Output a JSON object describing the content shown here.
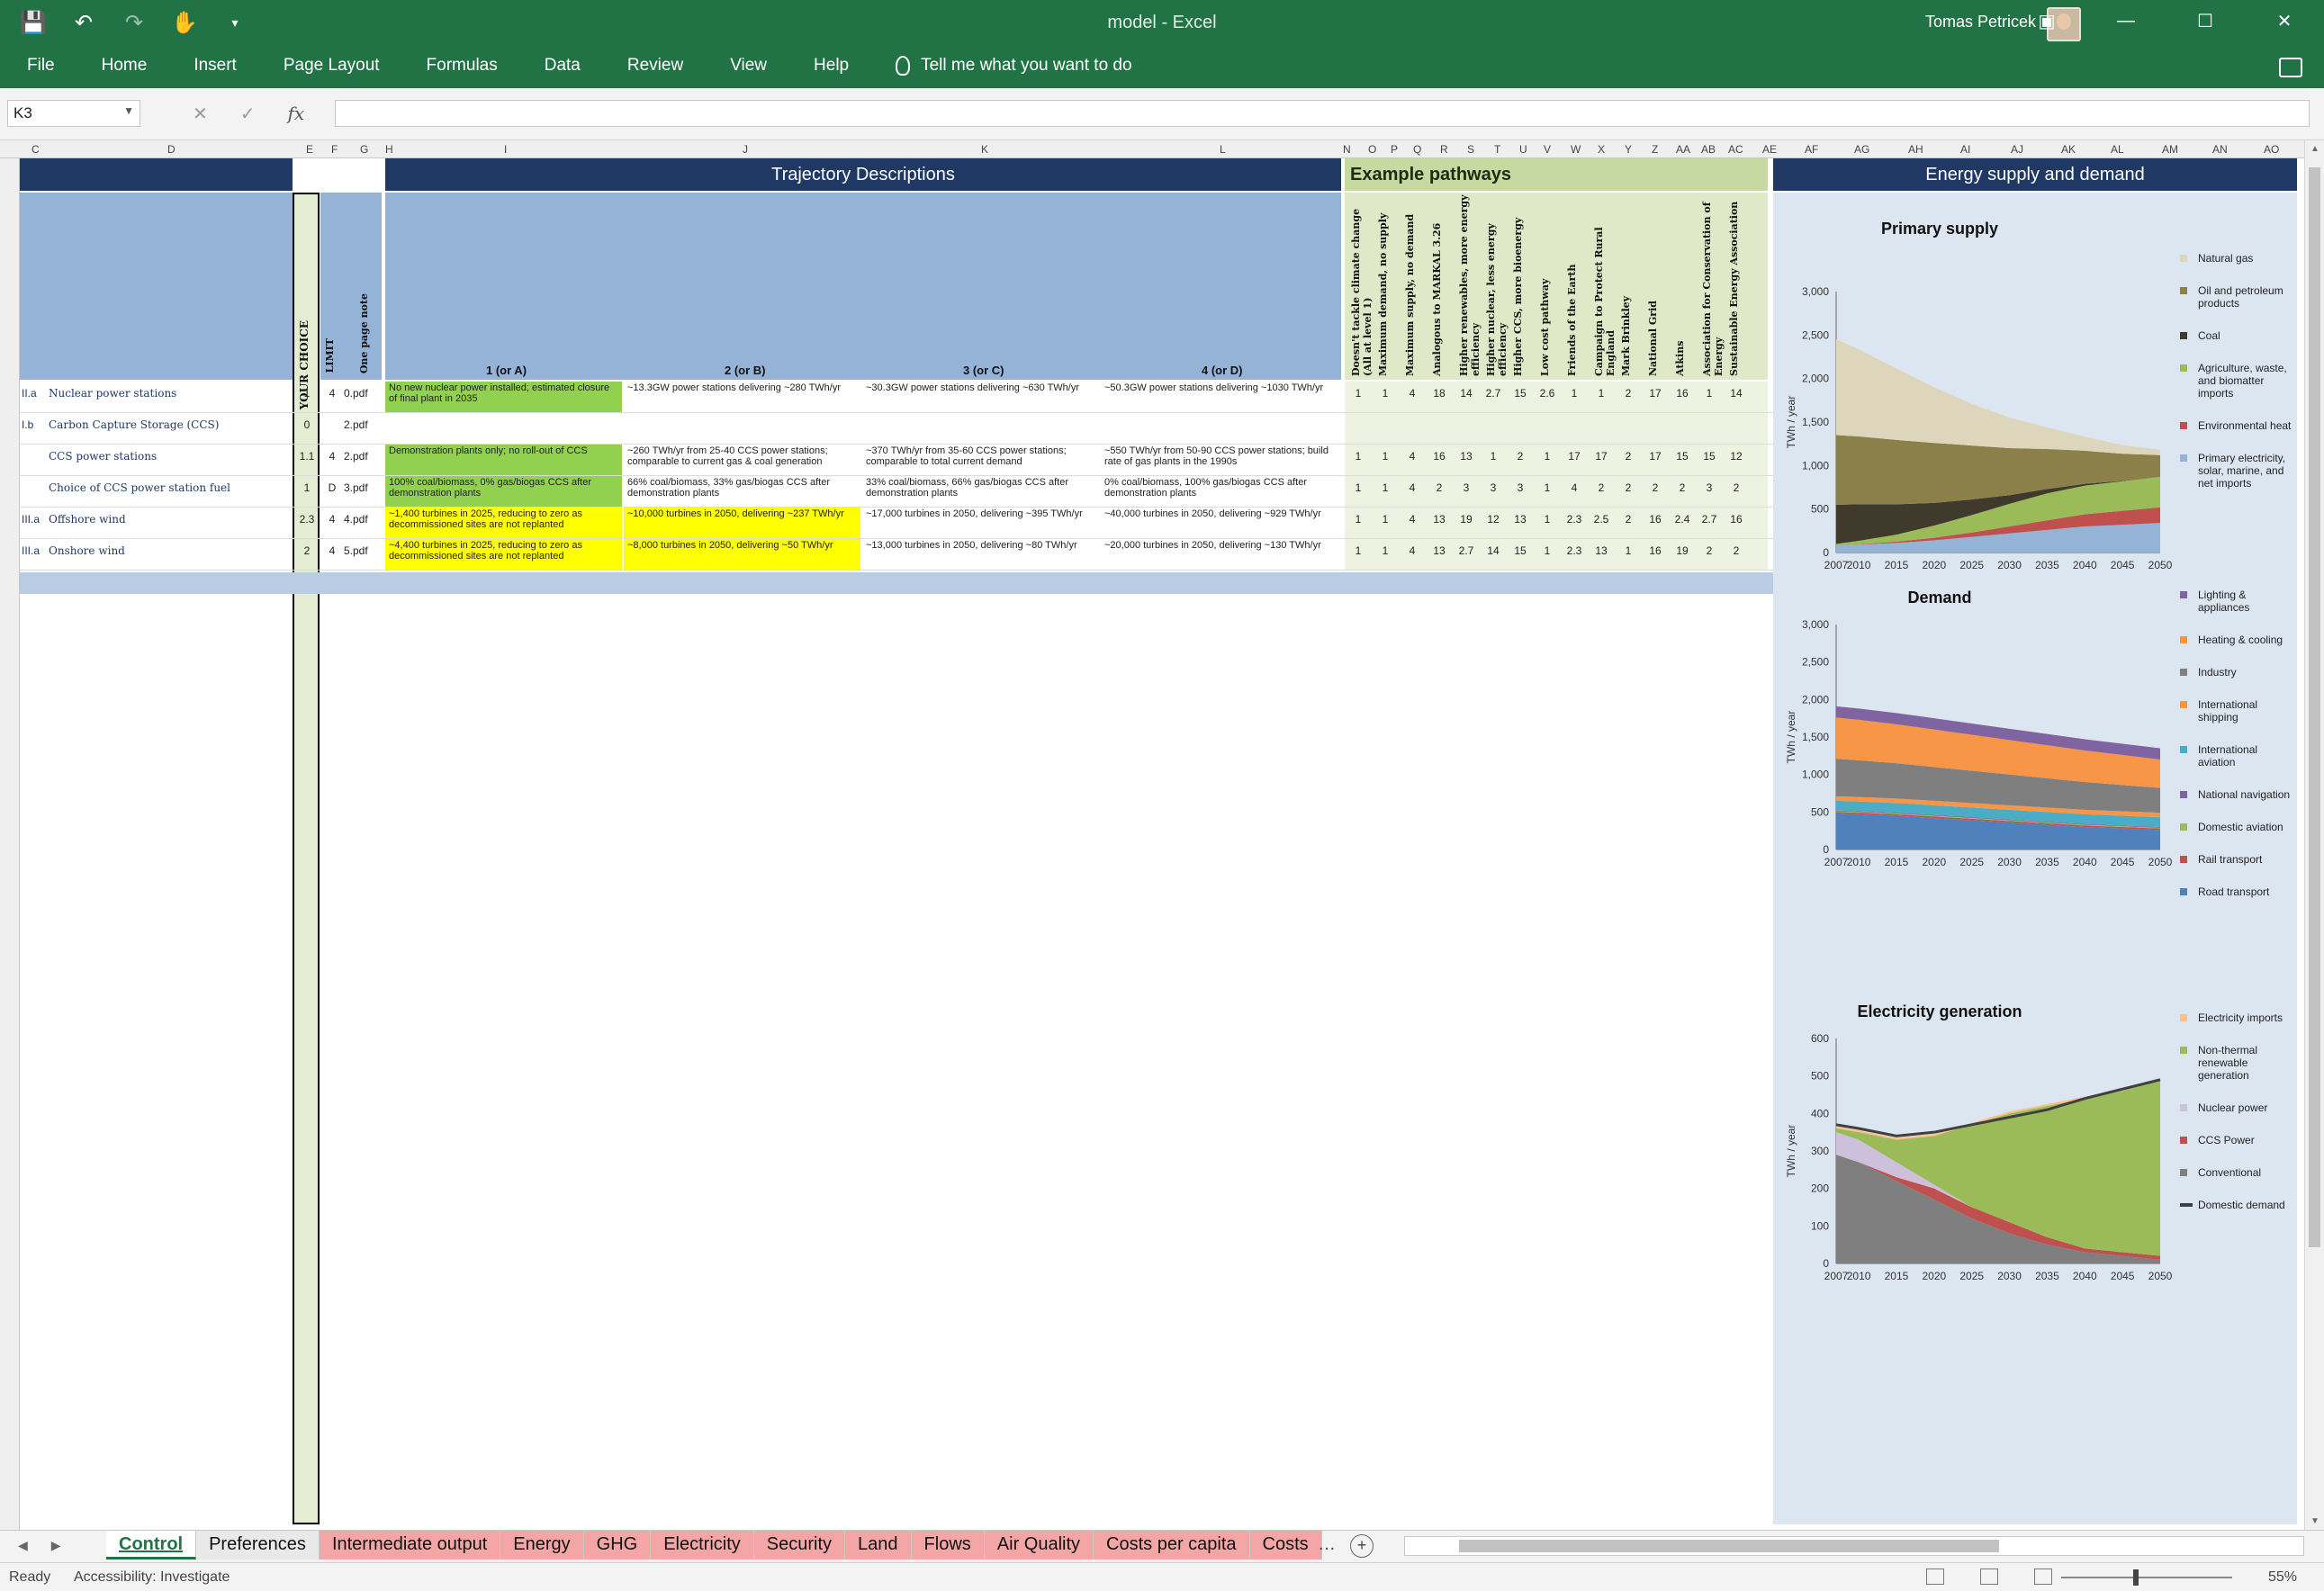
{
  "app": {
    "doc_title": "model",
    "app_name": "Excel",
    "title_sep": " - ",
    "user_name": "Tomas Petricek"
  },
  "ribbon_tabs": [
    "File",
    "Home",
    "Insert",
    "Page Layout",
    "Formulas",
    "Data",
    "Review",
    "View",
    "Help"
  ],
  "tell_me": "Tell me what you want to do",
  "formula_bar": {
    "name_box": "K3",
    "formula": ""
  },
  "column_letters": [
    "C",
    "D",
    "E",
    "F",
    "G",
    "H",
    "I",
    "J",
    "K",
    "L",
    "N",
    "O",
    "P",
    "Q",
    "R",
    "S",
    "T",
    "U",
    "V",
    "W",
    "X",
    "Y",
    "Z",
    "AA",
    "AB",
    "AC",
    "AE",
    "AF",
    "AG",
    "AH",
    "AI",
    "AJ",
    "AK",
    "AL",
    "AM",
    "AN",
    "AO"
  ],
  "bands": {
    "trajectory": "Trajectory Descriptions",
    "pathways": "Example pathways",
    "energy": "Energy supply and demand"
  },
  "header": {
    "your_choice": "YOUR CHOICE",
    "limit": "LIMIT",
    "one_page": "One page note",
    "levels": [
      "1 (or A)",
      "2 (or B)",
      "3 (or C)",
      "4 (or D)"
    ]
  },
  "pathway_names": [
    "Doesn't tackle climate change (All at level 1)",
    "Maximum demand, no supply",
    "Maximum supply, no demand",
    "Analogous to MARKAL 3.26",
    "Higher renewables, more energy efficiency",
    "Higher nuclear, less energy efficiency",
    "Higher CCS, more bioenergy",
    "Low cost pathway",
    "Friends of the Earth",
    "Campaign to Protect Rural England",
    "Mark Brinkley",
    "National Grid",
    "Atkins",
    "Association for Conservation of Energy",
    "Sustainable Energy Association"
  ],
  "rows": [
    {
      "id": "II.a",
      "name": "Nuclear power stations",
      "choice": "1",
      "limit": "4",
      "pdf": "0.pdf",
      "cells": [
        {
          "t": "No new nuclear power installed; estimated closure of final plant in 2035",
          "c": "green"
        },
        {
          "t": "~13.3GW power stations delivering ~280 TWh/yr",
          "c": ""
        },
        {
          "t": "~30.3GW power stations delivering ~630 TWh/yr",
          "c": ""
        },
        {
          "t": "~50.3GW power stations delivering ~1030 TWh/yr",
          "c": ""
        }
      ],
      "pw": [
        "1",
        "1",
        "4",
        "18",
        "14",
        "2.7",
        "15",
        "2.6",
        "1",
        "1",
        "2",
        "17",
        "16",
        "1",
        "14"
      ]
    },
    {
      "id": "I.b",
      "name": "Carbon Capture Storage (CCS)",
      "choice": "0",
      "limit": "",
      "pdf": "2.pdf",
      "cells": [],
      "pw": []
    },
    {
      "id": "",
      "name": "CCS power stations",
      "choice": "1.1",
      "limit": "4",
      "pdf": "2.pdf",
      "cells": [
        {
          "t": "Demonstration plants only; no roll-out of CCS",
          "c": "green"
        },
        {
          "t": "~260 TWh/yr from 25-40 CCS power stations; comparable to current gas & coal generation",
          "c": ""
        },
        {
          "t": "~370 TWh/yr from 35-60 CCS power stations; comparable to total current demand",
          "c": ""
        },
        {
          "t": "~550 TWh/yr from 50-90 CCS power stations; build rate of gas plants in the 1990s",
          "c": ""
        }
      ],
      "pw": [
        "1",
        "1",
        "4",
        "16",
        "13",
        "1",
        "2",
        "1",
        "17",
        "17",
        "2",
        "17",
        "15",
        "15",
        "12"
      ]
    },
    {
      "id": "",
      "name": "Choice of CCS power station fuel",
      "choice": "1",
      "limit": "D",
      "pdf": "3.pdf",
      "cells": [
        {
          "t": "100% coal/biomass, 0% gas/biogas CCS after demonstration plants",
          "c": "green"
        },
        {
          "t": "66% coal/biomass, 33% gas/biogas CCS after demonstration plants",
          "c": ""
        },
        {
          "t": "33% coal/biomass, 66% gas/biogas CCS after demonstration plants",
          "c": ""
        },
        {
          "t": "0% coal/biomass, 100% gas/biogas CCS after demonstration plants",
          "c": ""
        }
      ],
      "pw": [
        "1",
        "1",
        "4",
        "2",
        "3",
        "3",
        "3",
        "1",
        "4",
        "2",
        "2",
        "2",
        "2",
        "3",
        "2"
      ]
    },
    {
      "id": "III.a",
      "name": "Offshore wind",
      "choice": "2.3",
      "limit": "4",
      "pdf": "4.pdf",
      "cells": [
        {
          "t": "~1,400 turbines in 2025, reducing to zero as decommissioned sites are not replanted",
          "c": "yellow"
        },
        {
          "t": "~10,000 turbines in 2050, delivering ~237 TWh/yr",
          "c": "yellow"
        },
        {
          "t": "~17,000 turbines in 2050, delivering ~395 TWh/yr",
          "c": ""
        },
        {
          "t": "~40,000 turbines in 2050, delivering ~929 TWh/yr",
          "c": ""
        }
      ],
      "pw": [
        "1",
        "1",
        "4",
        "13",
        "19",
        "12",
        "13",
        "1",
        "2.3",
        "2.5",
        "2",
        "16",
        "2.4",
        "2.7",
        "16"
      ]
    },
    {
      "id": "III.a",
      "name": "Onshore wind",
      "choice": "2",
      "limit": "4",
      "pdf": "5.pdf",
      "cells": [
        {
          "t": "~4,400 turbines in 2025, reducing to zero as decommissioned sites are not replanted",
          "c": "yellow"
        },
        {
          "t": "~8,000 turbines in 2050, delivering ~50 TWh/yr",
          "c": "yellow"
        },
        {
          "t": "~13,000 turbines in 2050, delivering ~80 TWh/yr",
          "c": ""
        },
        {
          "t": "~20,000 turbines in 2050, delivering ~130 TWh/yr",
          "c": ""
        }
      ],
      "pw": [
        "1",
        "1",
        "4",
        "13",
        "2.7",
        "14",
        "15",
        "1",
        "2.3",
        "13",
        "1",
        "16",
        "19",
        "2",
        "2"
      ]
    }
  ],
  "primary_supply": {
    "title": "Primary supply",
    "chart_data": {
      "type": "area",
      "title": "Primary supply",
      "ylabel": "TWh / year",
      "x": [
        2007,
        2010,
        2015,
        2020,
        2025,
        2030,
        2035,
        2040,
        2045,
        2050
      ],
      "ylim": [
        0,
        3000
      ],
      "yticks": [
        "0",
        "500",
        "1,000",
        "1,500",
        "2,000",
        "2,500",
        "3,000"
      ],
      "series": [
        {
          "name": "Primary electricity, solar, marine, and net imports",
          "color": "#95b3d7",
          "values": [
            80,
            90,
            110,
            140,
            180,
            220,
            260,
            300,
            320,
            340
          ]
        },
        {
          "name": "Environmental heat",
          "color": "#c0504d",
          "values": [
            0,
            5,
            15,
            30,
            50,
            80,
            110,
            140,
            160,
            180
          ]
        },
        {
          "name": "Agriculture, waste, and biomatter imports",
          "color": "#9bbb59",
          "values": [
            20,
            40,
            80,
            140,
            200,
            260,
            310,
            330,
            340,
            350
          ]
        },
        {
          "name": "Coal",
          "color": "#403a2c",
          "values": [
            450,
            420,
            350,
            260,
            180,
            100,
            50,
            20,
            5,
            0
          ]
        },
        {
          "name": "Oil and petroleum products",
          "color": "#8b7f4a",
          "values": [
            800,
            780,
            740,
            690,
            620,
            540,
            460,
            380,
            310,
            250
          ]
        },
        {
          "name": "Natural gas",
          "color": "#ddd6bd",
          "values": [
            1100,
            1000,
            820,
            640,
            480,
            350,
            250,
            160,
            100,
            60
          ]
        }
      ]
    }
  },
  "demand": {
    "title": "Demand",
    "chart_data": {
      "type": "area",
      "title": "Demand",
      "ylabel": "TWh / year",
      "x": [
        2007,
        2010,
        2015,
        2020,
        2025,
        2030,
        2035,
        2040,
        2045,
        2050
      ],
      "ylim": [
        0,
        3000
      ],
      "yticks": [
        "0",
        "500",
        "1,000",
        "1,500",
        "2,000",
        "2,500",
        "3,000"
      ],
      "series": [
        {
          "name": "Road transport",
          "color": "#4f81bd",
          "values": [
            480,
            470,
            450,
            420,
            390,
            360,
            330,
            300,
            280,
            260
          ]
        },
        {
          "name": "Rail transport",
          "color": "#c0504d",
          "values": [
            20,
            20,
            20,
            20,
            20,
            20,
            20,
            20,
            20,
            20
          ]
        },
        {
          "name": "Domestic aviation",
          "color": "#9bbb59",
          "values": [
            10,
            10,
            10,
            10,
            10,
            10,
            10,
            10,
            10,
            10
          ]
        },
        {
          "name": "National navigation",
          "color": "#8064a2",
          "values": [
            10,
            10,
            10,
            10,
            10,
            10,
            10,
            10,
            10,
            10
          ]
        },
        {
          "name": "International aviation",
          "color": "#4bacc6",
          "values": [
            130,
            130,
            130,
            130,
            130,
            130,
            130,
            130,
            130,
            130
          ]
        },
        {
          "name": "International shipping",
          "color": "#f79646",
          "values": [
            60,
            60,
            60,
            60,
            60,
            60,
            60,
            60,
            60,
            60
          ]
        },
        {
          "name": "Industry",
          "color": "#7f7f7f",
          "values": [
            500,
            490,
            470,
            450,
            430,
            410,
            390,
            370,
            350,
            330
          ]
        },
        {
          "name": "Heating & cooling",
          "color": "#f79646",
          "values": [
            550,
            540,
            520,
            500,
            480,
            460,
            440,
            420,
            400,
            380
          ]
        },
        {
          "name": "Lighting & appliances",
          "color": "#8064a2",
          "values": [
            150,
            150,
            150,
            150,
            150,
            150,
            150,
            150,
            150,
            150
          ]
        }
      ]
    }
  },
  "electricity": {
    "title": "Electricity generation",
    "chart_data": {
      "type": "area",
      "title": "Electricity generation",
      "ylabel": "TWh / year",
      "x": [
        2007,
        2010,
        2015,
        2020,
        2025,
        2030,
        2035,
        2040,
        2045,
        2050
      ],
      "ylim": [
        0,
        600
      ],
      "yticks": [
        "0",
        "100",
        "200",
        "300",
        "400",
        "500",
        "600"
      ],
      "series": [
        {
          "name": "Conventional",
          "color": "#7f7f7f",
          "values": [
            290,
            270,
            220,
            170,
            120,
            80,
            50,
            30,
            20,
            10
          ]
        },
        {
          "name": "CCS Power",
          "color": "#c0504d",
          "values": [
            0,
            0,
            10,
            30,
            30,
            30,
            20,
            10,
            10,
            10
          ]
        },
        {
          "name": "Nuclear power",
          "color": "#ccc0da",
          "values": [
            60,
            60,
            40,
            10,
            0,
            0,
            0,
            0,
            0,
            0
          ]
        },
        {
          "name": "Non-thermal renewable generation",
          "color": "#9bbb59",
          "values": [
            10,
            20,
            60,
            130,
            220,
            290,
            350,
            400,
            430,
            470
          ]
        },
        {
          "name": "Electricity imports",
          "color": "#fac090",
          "values": [
            5,
            5,
            5,
            5,
            5,
            5,
            5,
            5,
            5,
            5
          ]
        }
      ],
      "lines": [
        {
          "name": "Domestic demand",
          "color": "#404040",
          "values": [
            370,
            360,
            340,
            350,
            370,
            390,
            410,
            440,
            465,
            490
          ]
        }
      ]
    }
  },
  "sheet_tabs": [
    "Control",
    "Preferences",
    "Intermediate output",
    "Energy",
    "GHG",
    "Electricity",
    "Security",
    "Land",
    "Flows",
    "Air Quality",
    "Costs per capita",
    "Costs"
  ],
  "status": {
    "ready": "Ready",
    "accessibility": "Accessibility: Investigate",
    "zoom": "55%"
  }
}
